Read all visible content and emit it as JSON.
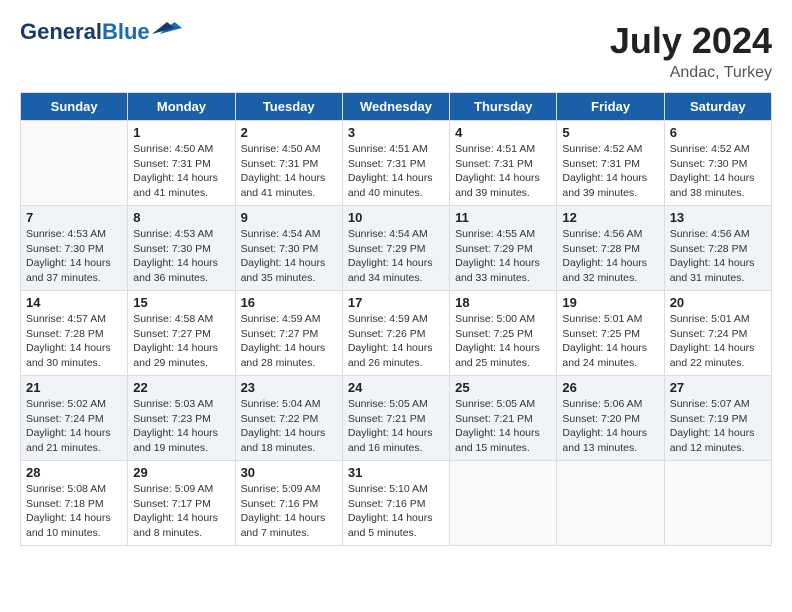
{
  "header": {
    "logo_line1": "General",
    "logo_line2": "Blue",
    "month_year": "July 2024",
    "location": "Andac, Turkey"
  },
  "days_of_week": [
    "Sunday",
    "Monday",
    "Tuesday",
    "Wednesday",
    "Thursday",
    "Friday",
    "Saturday"
  ],
  "weeks": [
    [
      {
        "day": "",
        "info": ""
      },
      {
        "day": "1",
        "info": "Sunrise: 4:50 AM\nSunset: 7:31 PM\nDaylight: 14 hours\nand 41 minutes."
      },
      {
        "day": "2",
        "info": "Sunrise: 4:50 AM\nSunset: 7:31 PM\nDaylight: 14 hours\nand 41 minutes."
      },
      {
        "day": "3",
        "info": "Sunrise: 4:51 AM\nSunset: 7:31 PM\nDaylight: 14 hours\nand 40 minutes."
      },
      {
        "day": "4",
        "info": "Sunrise: 4:51 AM\nSunset: 7:31 PM\nDaylight: 14 hours\nand 39 minutes."
      },
      {
        "day": "5",
        "info": "Sunrise: 4:52 AM\nSunset: 7:31 PM\nDaylight: 14 hours\nand 39 minutes."
      },
      {
        "day": "6",
        "info": "Sunrise: 4:52 AM\nSunset: 7:30 PM\nDaylight: 14 hours\nand 38 minutes."
      }
    ],
    [
      {
        "day": "7",
        "info": "Sunrise: 4:53 AM\nSunset: 7:30 PM\nDaylight: 14 hours\nand 37 minutes."
      },
      {
        "day": "8",
        "info": "Sunrise: 4:53 AM\nSunset: 7:30 PM\nDaylight: 14 hours\nand 36 minutes."
      },
      {
        "day": "9",
        "info": "Sunrise: 4:54 AM\nSunset: 7:30 PM\nDaylight: 14 hours\nand 35 minutes."
      },
      {
        "day": "10",
        "info": "Sunrise: 4:54 AM\nSunset: 7:29 PM\nDaylight: 14 hours\nand 34 minutes."
      },
      {
        "day": "11",
        "info": "Sunrise: 4:55 AM\nSunset: 7:29 PM\nDaylight: 14 hours\nand 33 minutes."
      },
      {
        "day": "12",
        "info": "Sunrise: 4:56 AM\nSunset: 7:28 PM\nDaylight: 14 hours\nand 32 minutes."
      },
      {
        "day": "13",
        "info": "Sunrise: 4:56 AM\nSunset: 7:28 PM\nDaylight: 14 hours\nand 31 minutes."
      }
    ],
    [
      {
        "day": "14",
        "info": "Sunrise: 4:57 AM\nSunset: 7:28 PM\nDaylight: 14 hours\nand 30 minutes."
      },
      {
        "day": "15",
        "info": "Sunrise: 4:58 AM\nSunset: 7:27 PM\nDaylight: 14 hours\nand 29 minutes."
      },
      {
        "day": "16",
        "info": "Sunrise: 4:59 AM\nSunset: 7:27 PM\nDaylight: 14 hours\nand 28 minutes."
      },
      {
        "day": "17",
        "info": "Sunrise: 4:59 AM\nSunset: 7:26 PM\nDaylight: 14 hours\nand 26 minutes."
      },
      {
        "day": "18",
        "info": "Sunrise: 5:00 AM\nSunset: 7:25 PM\nDaylight: 14 hours\nand 25 minutes."
      },
      {
        "day": "19",
        "info": "Sunrise: 5:01 AM\nSunset: 7:25 PM\nDaylight: 14 hours\nand 24 minutes."
      },
      {
        "day": "20",
        "info": "Sunrise: 5:01 AM\nSunset: 7:24 PM\nDaylight: 14 hours\nand 22 minutes."
      }
    ],
    [
      {
        "day": "21",
        "info": "Sunrise: 5:02 AM\nSunset: 7:24 PM\nDaylight: 14 hours\nand 21 minutes."
      },
      {
        "day": "22",
        "info": "Sunrise: 5:03 AM\nSunset: 7:23 PM\nDaylight: 14 hours\nand 19 minutes."
      },
      {
        "day": "23",
        "info": "Sunrise: 5:04 AM\nSunset: 7:22 PM\nDaylight: 14 hours\nand 18 minutes."
      },
      {
        "day": "24",
        "info": "Sunrise: 5:05 AM\nSunset: 7:21 PM\nDaylight: 14 hours\nand 16 minutes."
      },
      {
        "day": "25",
        "info": "Sunrise: 5:05 AM\nSunset: 7:21 PM\nDaylight: 14 hours\nand 15 minutes."
      },
      {
        "day": "26",
        "info": "Sunrise: 5:06 AM\nSunset: 7:20 PM\nDaylight: 14 hours\nand 13 minutes."
      },
      {
        "day": "27",
        "info": "Sunrise: 5:07 AM\nSunset: 7:19 PM\nDaylight: 14 hours\nand 12 minutes."
      }
    ],
    [
      {
        "day": "28",
        "info": "Sunrise: 5:08 AM\nSunset: 7:18 PM\nDaylight: 14 hours\nand 10 minutes."
      },
      {
        "day": "29",
        "info": "Sunrise: 5:09 AM\nSunset: 7:17 PM\nDaylight: 14 hours\nand 8 minutes."
      },
      {
        "day": "30",
        "info": "Sunrise: 5:09 AM\nSunset: 7:16 PM\nDaylight: 14 hours\nand 7 minutes."
      },
      {
        "day": "31",
        "info": "Sunrise: 5:10 AM\nSunset: 7:16 PM\nDaylight: 14 hours\nand 5 minutes."
      },
      {
        "day": "",
        "info": ""
      },
      {
        "day": "",
        "info": ""
      },
      {
        "day": "",
        "info": ""
      }
    ]
  ]
}
